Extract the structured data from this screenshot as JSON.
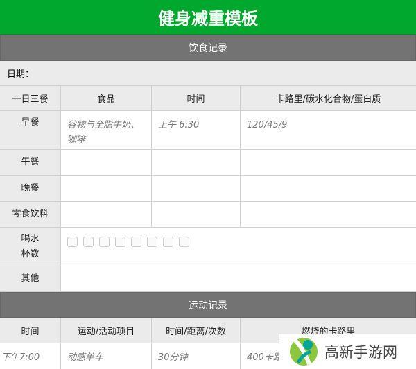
{
  "title": "健身减重模板",
  "diet": {
    "band": "饮食记录",
    "date_label": "日期：",
    "headers": [
      "一日三餐",
      "食品",
      "时间",
      "卡路里/碳水化合物/蛋白质"
    ],
    "rows": [
      {
        "meal": "早餐",
        "food": "谷物与全脂牛奶、咖啡",
        "time": "上午 6:30",
        "nutrition": "120/45/9"
      },
      {
        "meal": "午餐",
        "food": "",
        "time": "",
        "nutrition": ""
      },
      {
        "meal": "晚餐",
        "food": "",
        "time": "",
        "nutrition": ""
      },
      {
        "meal": "零食饮料",
        "food": "",
        "time": "",
        "nutrition": ""
      }
    ],
    "water_label": "喝水杯数",
    "water_cups": 8,
    "water_checked": 0,
    "other_label": "其他"
  },
  "exercise": {
    "band": "运动记录",
    "headers": [
      "时间",
      "运动/活动项目",
      "时间/距离/次数",
      "燃烧的卡路里"
    ],
    "rows": [
      {
        "time": "下午7:00",
        "activity": "动感单车",
        "amount": "30分钟",
        "calories": "400卡路里"
      }
    ]
  },
  "watermark": "高新手游网"
}
